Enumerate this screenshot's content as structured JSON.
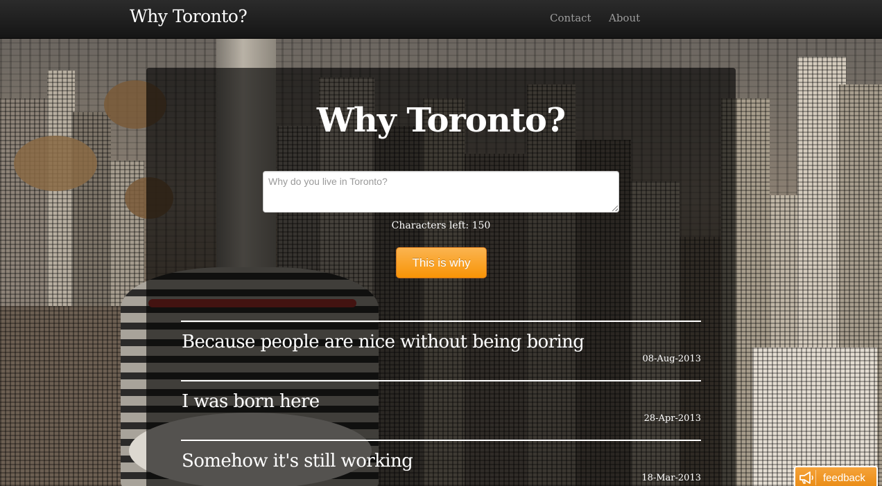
{
  "navbar": {
    "brand": "Why Toronto?",
    "links": [
      {
        "label": "Contact"
      },
      {
        "label": "About"
      }
    ]
  },
  "main": {
    "title": "Why Toronto?",
    "input_placeholder": "Why do you live in Toronto?",
    "chars_left": "Characters left: 150",
    "submit_label": "This is why"
  },
  "entries": [
    {
      "text": "Because people are nice without being boring",
      "date": "08-Aug-2013"
    },
    {
      "text": "I was born here",
      "date": "28-Apr-2013"
    },
    {
      "text": "Somehow it's still working",
      "date": "18-Mar-2013"
    }
  ],
  "feedback": {
    "label": "feedback",
    "icon": "megaphone-icon"
  },
  "colors": {
    "navbar": "#1b1b1b",
    "button": "#f89406",
    "feedback": "#ef9420"
  }
}
